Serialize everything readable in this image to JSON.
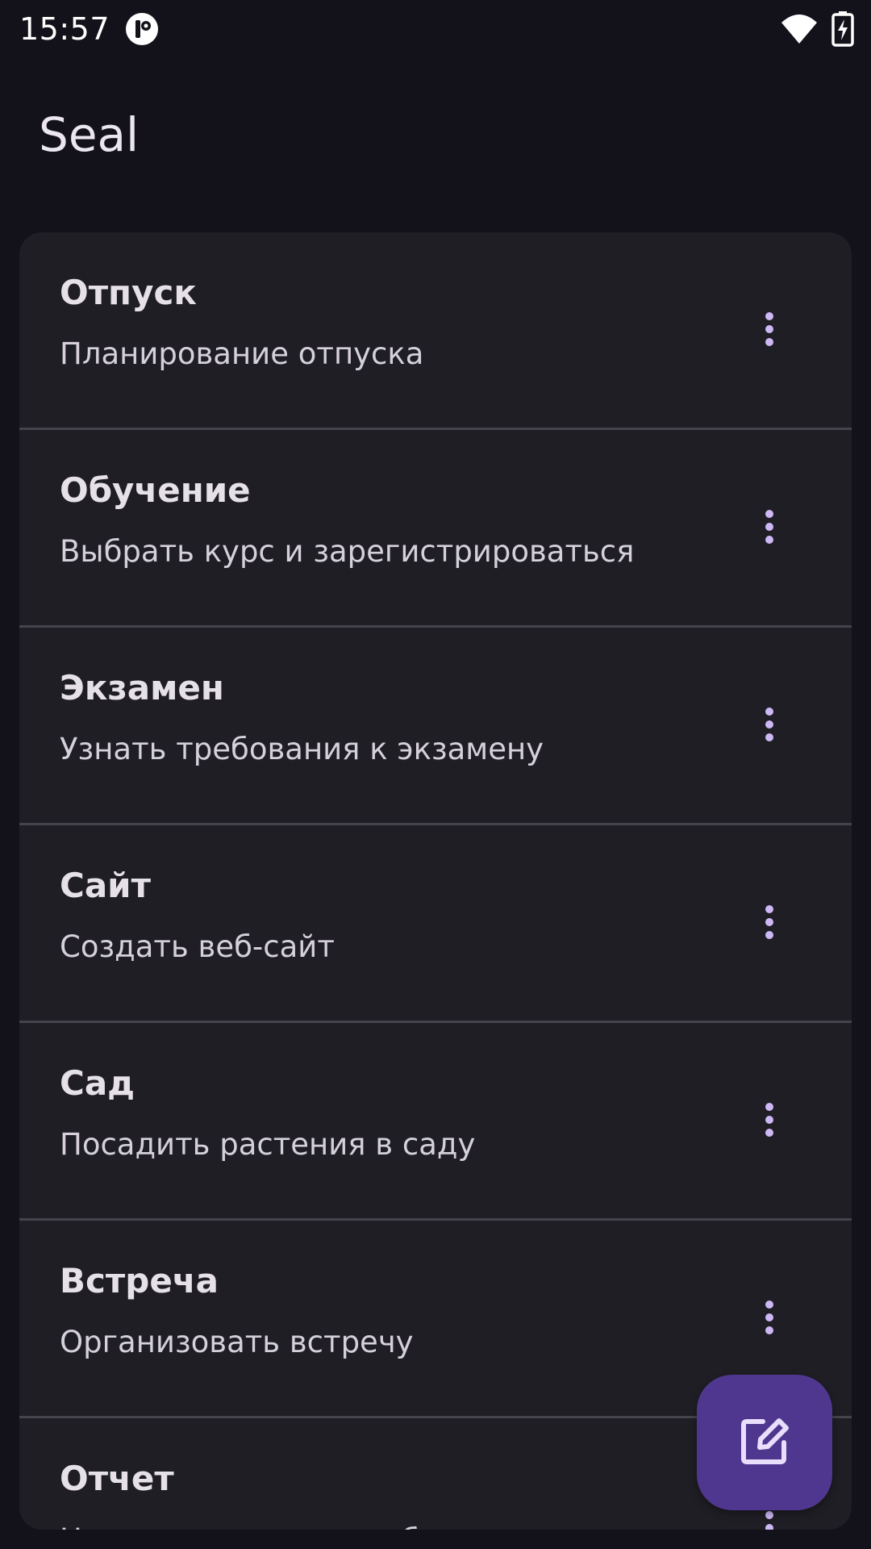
{
  "status_bar": {
    "time": "15:57",
    "icons": [
      "app-notification-icon",
      "wifi-icon",
      "battery-charging-icon"
    ]
  },
  "app_bar": {
    "title": "Seal"
  },
  "notes": [
    {
      "title": "Отпуск",
      "subtitle": "Планирование отпуска"
    },
    {
      "title": "Обучение",
      "subtitle": "Выбрать курс и зарегистрироваться"
    },
    {
      "title": "Экзамен",
      "subtitle": "Узнать требования к экзамену"
    },
    {
      "title": "Сайт",
      "subtitle": "Создать веб-сайт"
    },
    {
      "title": "Сад",
      "subtitle": "Посадить растения в саду"
    },
    {
      "title": "Встреча",
      "subtitle": "Организовать встречу"
    },
    {
      "title": "Отчет",
      "subtitle": "Написать отчет по работе"
    }
  ],
  "item_menu_icon": "more-vert-icon",
  "fab": {
    "icon": "edit-icon"
  },
  "colors": {
    "background": "#13121a",
    "card": "#1f1e24",
    "divider": "#45434b",
    "accent": "#cdb8f5",
    "fab": "#4f3790"
  }
}
